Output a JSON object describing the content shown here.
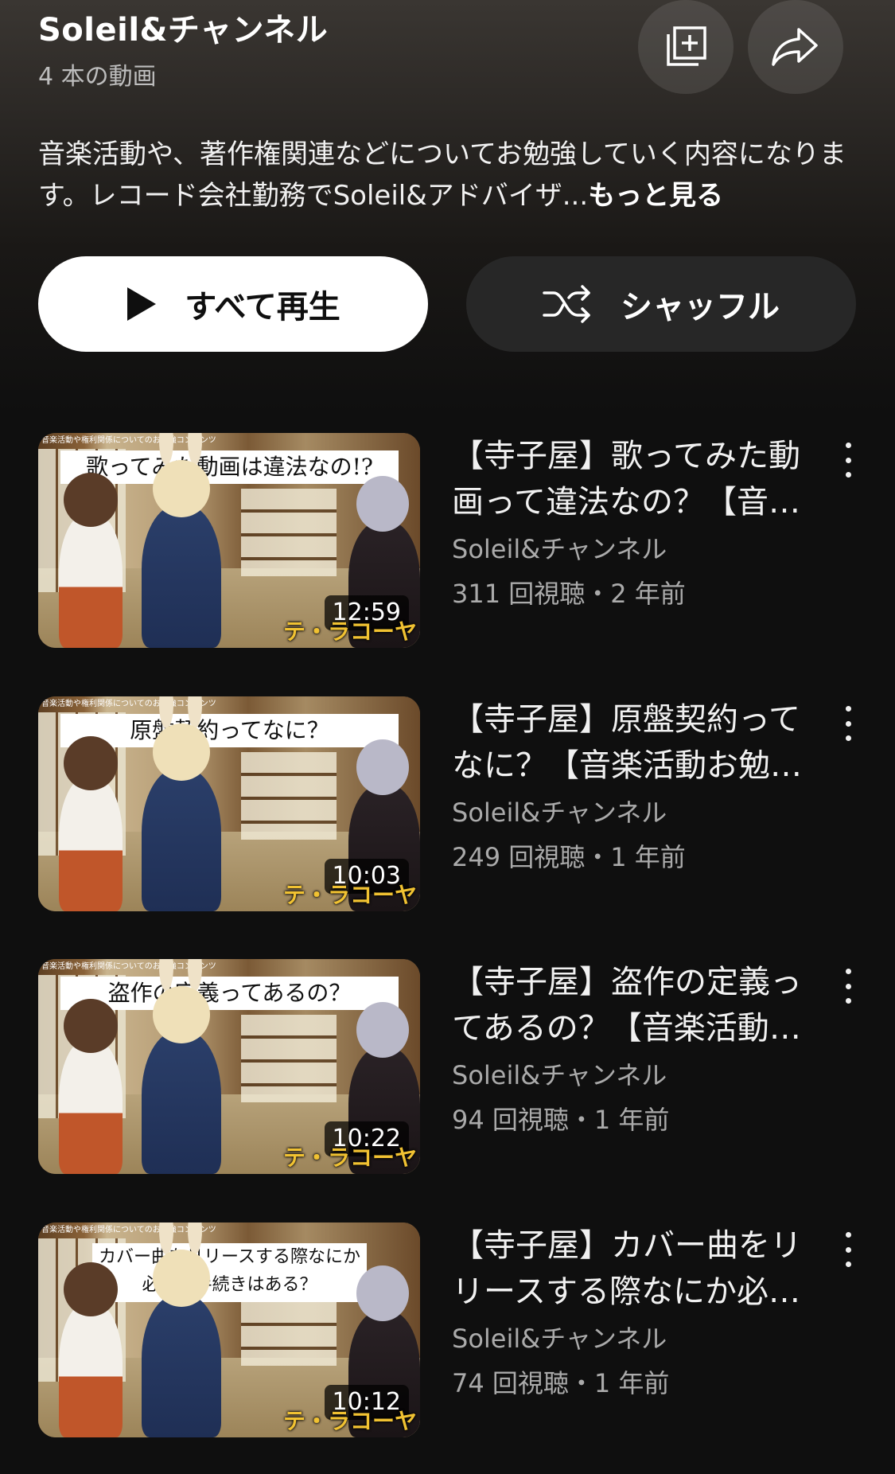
{
  "playlist": {
    "title": "Soleil&チャンネル",
    "count": "4 本の動画",
    "description": "音楽活動や、著作権関連などについてお勉強していく内容になります。レコード会社勤務でSoleil&アドバイザ...",
    "more_label": "もっと見る"
  },
  "actions": {
    "play_all": "すべて再生",
    "shuffle": "シャッフル"
  },
  "icons": {
    "save": "add-to-library-icon",
    "share": "share-icon",
    "play": "play-icon",
    "shuffle": "shuffle-icon",
    "more": "more-vert-icon"
  },
  "videos": [
    {
      "thumb_topline": "音楽活動や権利関係についてのお勉強コンテンツ",
      "thumb_caption": "歌ってみた動画は違法なの!?",
      "thumb_brand": "テ・ラコーヤ",
      "duration": "12:59",
      "title": "【寺子屋】歌ってみた動画って違法なの？【音楽活動お勉強コンテンツ】",
      "channel": "Soleil&チャンネル",
      "meta": "311 回視聴・2 年前"
    },
    {
      "thumb_topline": "音楽活動や権利関係についてのお勉強コンテンツ",
      "thumb_caption": "原盤契約ってなに？",
      "thumb_brand": "テ・ラコーヤ",
      "duration": "10:03",
      "title": "【寺子屋】原盤契約ってなに？【音楽活動お勉強コンテンツ】",
      "channel": "Soleil&チャンネル",
      "meta": "249 回視聴・1 年前"
    },
    {
      "thumb_topline": "音楽活動や権利関係についてのお勉強コンテンツ",
      "thumb_caption": "盗作の定義ってあるの？",
      "thumb_brand": "テ・ラコーヤ",
      "duration": "10:22",
      "title": "【寺子屋】盗作の定義ってあるの？【音楽活動お勉強コンテンツ】",
      "channel": "Soleil&チャンネル",
      "meta": "94 回視聴・1 年前"
    },
    {
      "thumb_topline": "音楽活動や権利関係についてのお勉強コンテンツ",
      "thumb_caption": "カバー曲をリリースする際なにか必要な手続きはある？",
      "thumb_brand": "テ・ラコーヤ",
      "duration": "10:12",
      "title": "【寺子屋】カバー曲をリリースする際なにか必要な手続きはある？",
      "channel": "Soleil&チャンネル",
      "meta": "74 回視聴・1 年前"
    }
  ]
}
